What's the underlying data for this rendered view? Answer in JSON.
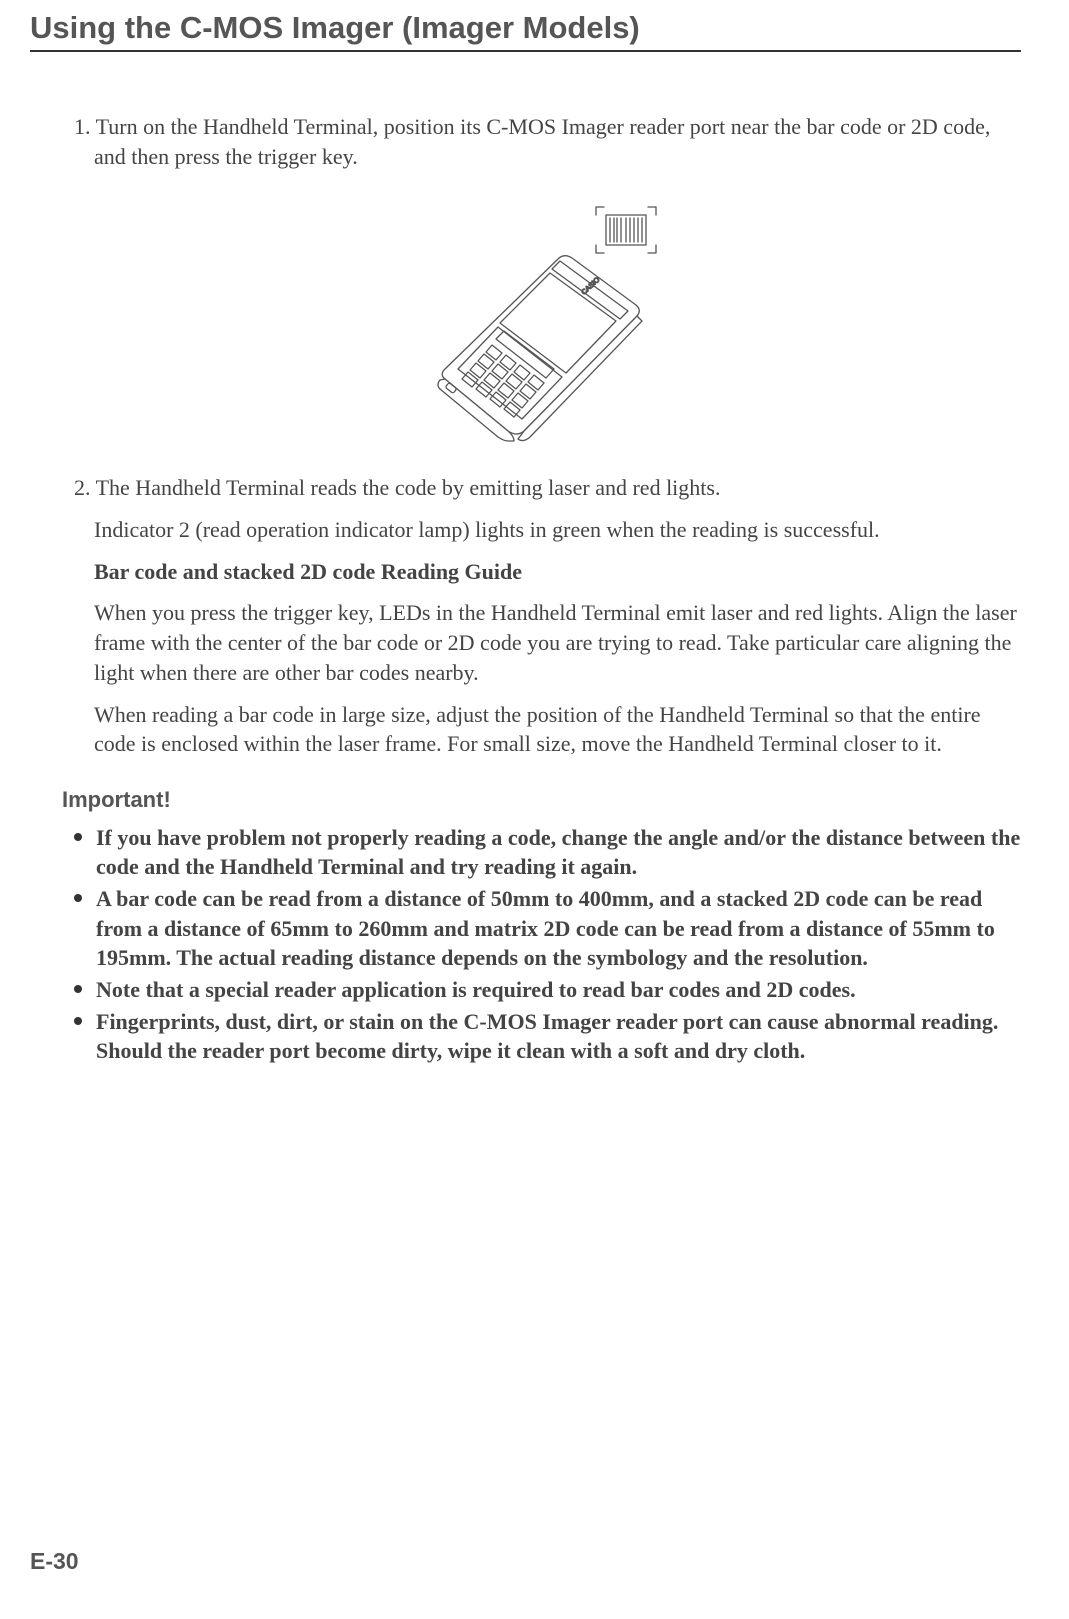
{
  "title": "Using the C-MOS Imager (Imager Models)",
  "step1": "1. Turn on the Handheld Terminal, position its C-MOS Imager reader port near the bar code or 2D code, and then press the trigger key.",
  "step2": {
    "line1": "2. The Handheld Terminal reads the code by emitting laser and red lights.",
    "line2": "Indicator 2 (read operation indicator lamp) lights in green when the reading is successful.",
    "sub_head": "Bar code and stacked 2D code Reading Guide",
    "line3": "When you press the trigger key, LEDs in the Handheld Terminal emit laser and red lights. Align the laser frame with the center of the bar code or 2D code you are trying to read. Take particular care aligning the light when there are other bar codes nearby.",
    "line4": "When reading a bar code in large size, adjust the position of the Handheld Terminal so that the entire code is enclosed within the laser frame. For small size, move the Handheld Terminal closer to it."
  },
  "important": {
    "heading": "Important!",
    "items": [
      "If you have problem not properly reading a code, change the angle and/or the distance between the code and the Handheld Terminal and try reading it again.",
      "A bar code can be read from a distance of 50mm to 400mm, and a stacked 2D code can be read from a distance of 65mm to 260mm and matrix 2D code can be read from a distance of 55mm to 195mm.  The actual reading distance depends on the symbology and the resolution.",
      "Note that a special reader application is required to read bar codes and 2D codes.",
      "Fingerprints, dust, dirt, or stain on the C-MOS Imager reader port can cause abnormal reading. Should the reader port become dirty, wipe it clean with a soft and dry cloth."
    ]
  },
  "page_number": "E-30"
}
